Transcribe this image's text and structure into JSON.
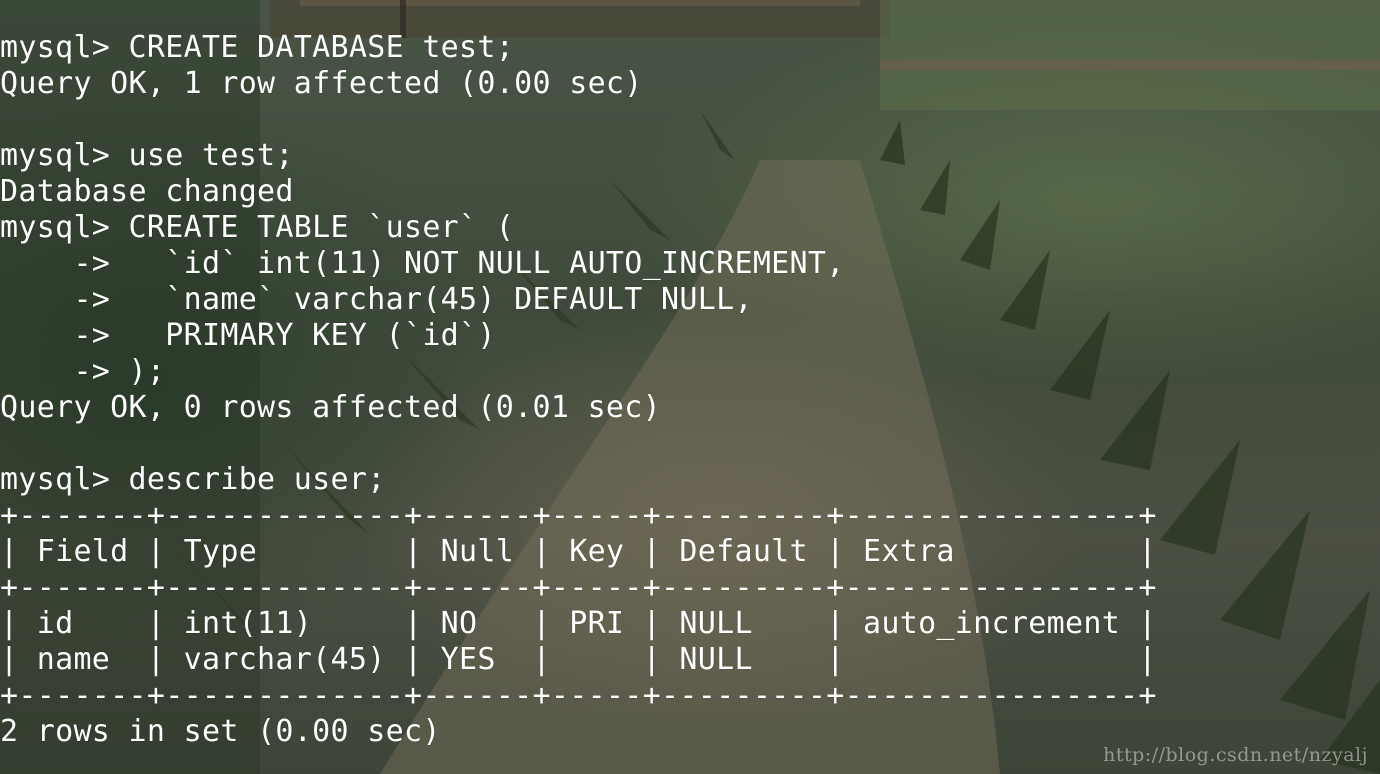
{
  "terminal": {
    "lines": [
      "mysql> CREATE DATABASE test;",
      "Query OK, 1 row affected (0.00 sec)",
      "",
      "mysql> use test;",
      "Database changed",
      "mysql> CREATE TABLE `user` (",
      "    ->   `id` int(11) NOT NULL AUTO_INCREMENT,",
      "    ->   `name` varchar(45) DEFAULT NULL,",
      "    ->   PRIMARY KEY (`id`)",
      "    -> );",
      "Query OK, 0 rows affected (0.01 sec)",
      "",
      "mysql> describe user;",
      "+-------+-------------+------+-----+---------+----------------+",
      "| Field | Type        | Null | Key | Default | Extra          |",
      "+-------+-------------+------+-----+---------+----------------+",
      "| id    | int(11)     | NO   | PRI | NULL    | auto_increment |",
      "| name  | varchar(45) | YES  |     | NULL    |                |",
      "+-------+-------------+------+-----+---------+----------------+",
      "2 rows in set (0.00 sec)"
    ]
  },
  "watermark": "http://blog.csdn.net/nzyalj",
  "colors": {
    "text": "#ffffff",
    "background": "#3f4b3a"
  }
}
